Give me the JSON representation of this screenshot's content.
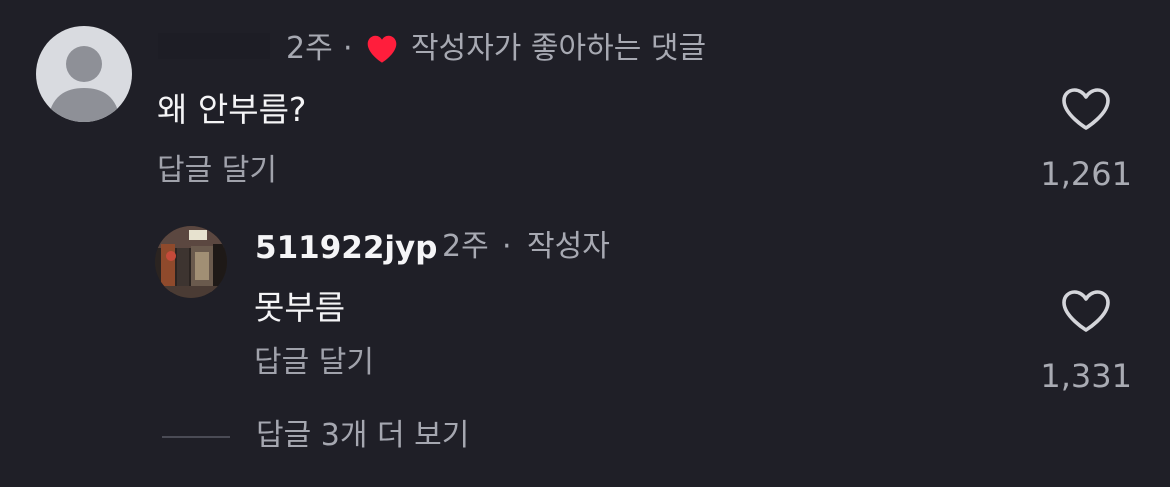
{
  "comment": {
    "time": "2주",
    "separator": "·",
    "creator_liked_label": "작성자가 좋아하는 댓글",
    "text": "왜 안부름?",
    "reply_label": "답글 달기",
    "like_count": "1,261",
    "heart_color": "#ff1e3c"
  },
  "reply": {
    "username": "511922jyp",
    "time": "2주",
    "separator": "·",
    "author_badge": "작성자",
    "text": "못부름",
    "reply_label": "답글 달기",
    "like_count": "1,331"
  },
  "view_more": {
    "label": "답글 3개 더 보기"
  },
  "icons": {
    "default_avatar": "person-silhouette",
    "heart_filled": "heart-filled-icon",
    "heart_outline": "heart-outline-icon"
  }
}
